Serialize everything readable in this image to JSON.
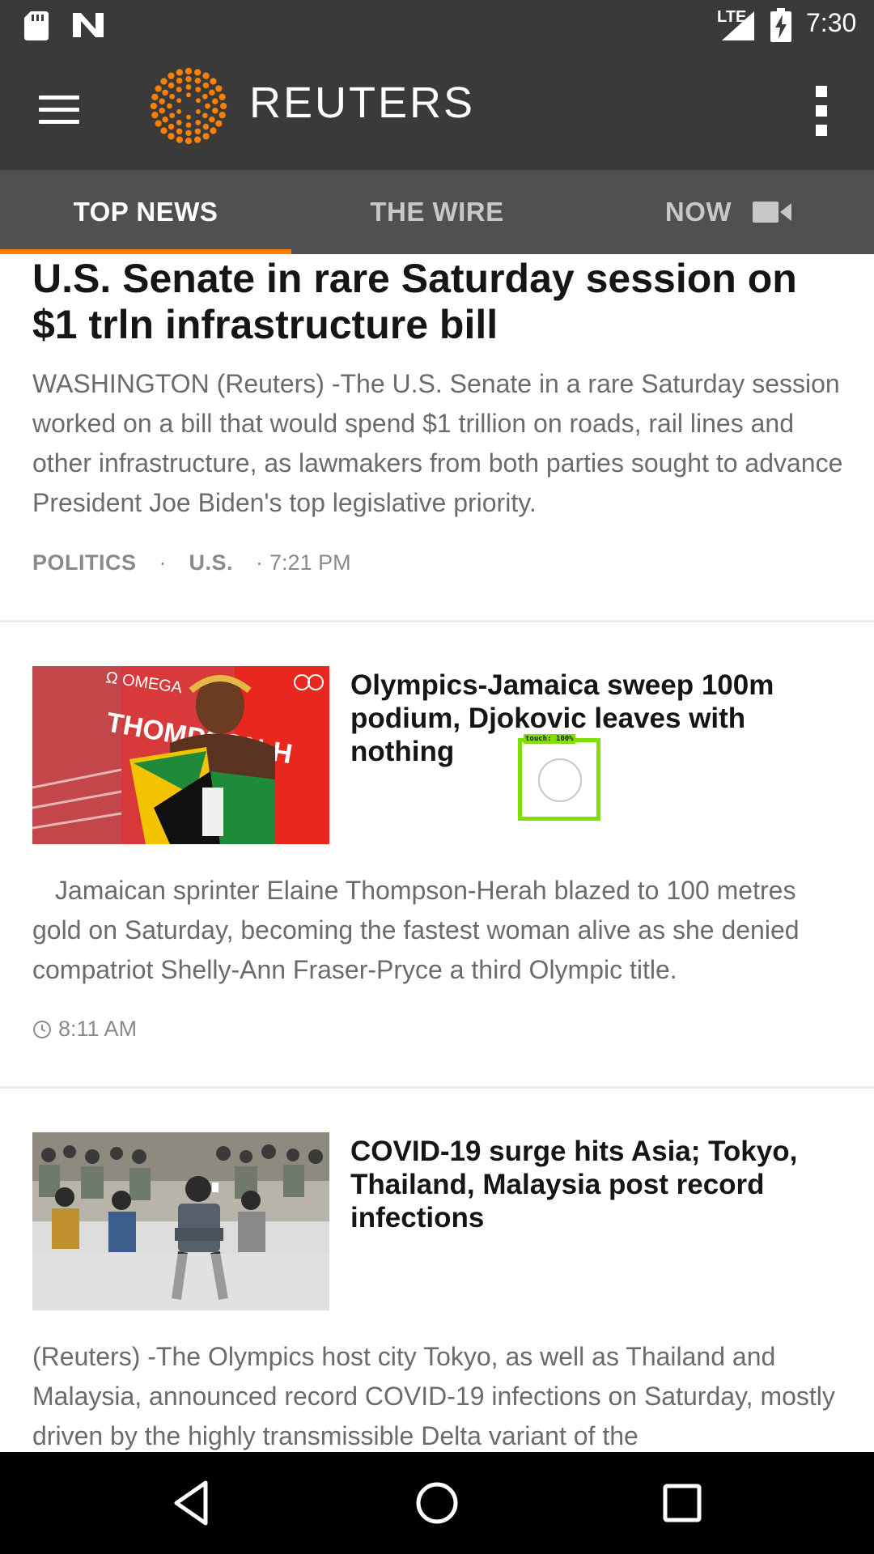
{
  "status_bar": {
    "network": "LTE",
    "time": "7:30",
    "icons": [
      "sd-card-icon",
      "n-notification-icon",
      "signal-icon",
      "battery-charging-icon"
    ]
  },
  "app_bar": {
    "brand": "REUTERS",
    "menu_icon": "hamburger-menu-icon",
    "overflow_icon": "more-vert-icon",
    "logo_color": "#ff8000"
  },
  "tabs": [
    {
      "label": "TOP NEWS",
      "active": true
    },
    {
      "label": "THE WIRE",
      "active": false
    },
    {
      "label": "NOW",
      "active": false,
      "icon": "video-camera-icon"
    }
  ],
  "lead_story": {
    "headline": "U.S. Senate in rare Saturday session on $1 trln infrastructure bill",
    "summary": "WASHINGTON (Reuters) -The U.S. Senate in a rare Saturday session worked on a bill that would spend $1 trillion on roads, rail lines and other infrastructure, as lawmakers from both parties sought to advance President Joe Biden's top legislative priority.",
    "category_1": "POLITICS",
    "separator": "·",
    "category_2": "U.S.",
    "time": "7:21 PM"
  },
  "stories": [
    {
      "headline": "Olympics-Jamaica sweep 100m podium, Djokovic leaves with nothing",
      "summary": "Jamaican sprinter Elaine Thompson-Herah blazed to 100 metres gold on Saturday, becoming the fastest woman alive as she denied compatriot Shelly-Ann Fraser-Pryce a third Olympic title.",
      "time": "8:11 AM",
      "thumb_text": "THOMPSON-H"
    },
    {
      "headline": "COVID-19 surge hits Asia; Tokyo, Thailand, Malaysia post record infections",
      "summary": "(Reuters) -The Olympics host city Tokyo, as well as Thailand and Malaysia, announced record COVID-19 infections on Saturday, mostly driven by the highly transmissible Delta variant of the"
    }
  ],
  "touch_overlay": {
    "label": "touch: 100%"
  },
  "nav_bar": {
    "icons": [
      "back-icon",
      "home-icon",
      "recents-icon"
    ]
  }
}
